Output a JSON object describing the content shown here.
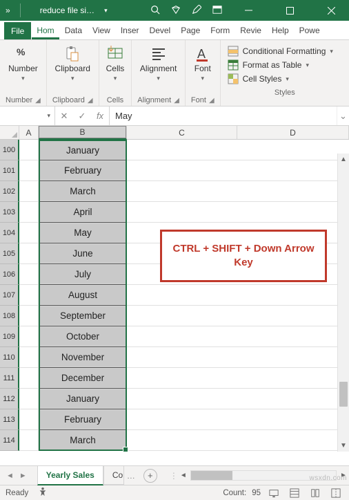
{
  "titlebar": {
    "more": "»",
    "filename": "reduce file si…"
  },
  "tabs": {
    "file": "File",
    "items": [
      "Hom",
      "Data",
      "View",
      "Inser",
      "Devel",
      "Page",
      "Form",
      "Revie",
      "Help",
      "Powe"
    ],
    "active_index": 0
  },
  "ribbon": {
    "number": {
      "label": "Number"
    },
    "clipboard": {
      "label": "Clipboard"
    },
    "cells": {
      "label": "Cells"
    },
    "alignment": {
      "label": "Alignment"
    },
    "font": {
      "label": "Font"
    },
    "styles": {
      "conditional": "Conditional Formatting",
      "table": "Format as Table",
      "cell": "Cell Styles",
      "label": "Styles"
    }
  },
  "formula_bar": {
    "namebox": "",
    "value": "May"
  },
  "columns": [
    "A",
    "B",
    "C",
    "D"
  ],
  "rows": [
    {
      "num": "100",
      "b": "January"
    },
    {
      "num": "101",
      "b": "February"
    },
    {
      "num": "102",
      "b": "March"
    },
    {
      "num": "103",
      "b": "April"
    },
    {
      "num": "104",
      "b": "May"
    },
    {
      "num": "105",
      "b": "June"
    },
    {
      "num": "106",
      "b": "July"
    },
    {
      "num": "107",
      "b": "August"
    },
    {
      "num": "108",
      "b": "September"
    },
    {
      "num": "109",
      "b": "October"
    },
    {
      "num": "110",
      "b": "November"
    },
    {
      "num": "111",
      "b": "December"
    },
    {
      "num": "112",
      "b": "January"
    },
    {
      "num": "113",
      "b": "February"
    },
    {
      "num": "114",
      "b": "March"
    }
  ],
  "callout": "CTRL + SHIFT + Down Arrow Key",
  "sheets": {
    "active": "Yearly Sales",
    "next": "Co"
  },
  "status": {
    "mode": "Ready",
    "acc": "",
    "count_label": "Count:",
    "count_value": "95"
  },
  "watermark": "wsxdn.com"
}
